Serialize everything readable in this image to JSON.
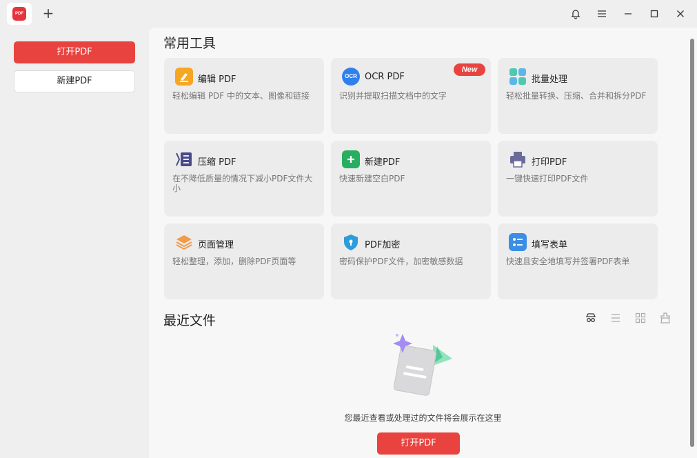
{
  "titlebar": {
    "app_logo_text": "PDF",
    "new_tab_symbol": "+",
    "icons": [
      "bell-icon",
      "menu-icon",
      "minimize-icon",
      "maximize-icon",
      "close-icon"
    ]
  },
  "sidebar": {
    "open_label": "打开PDF",
    "new_label": "新建PDF"
  },
  "tools": {
    "title": "常用工具",
    "items": [
      {
        "title": "编辑 PDF",
        "desc": "轻松编辑 PDF 中的文本、图像和链接",
        "icon": "edit-icon",
        "color": "#f5a623"
      },
      {
        "title": "OCR PDF",
        "desc": "识别并提取扫描文档中的文字",
        "icon": "ocr-icon",
        "color": "#2f80ed",
        "badge": "New",
        "icon_text": "OCR"
      },
      {
        "title": "批量处理",
        "desc": "轻松批量转换、压缩、合并和拆分PDF",
        "icon": "batch-icon",
        "color": "#4ec9b0"
      },
      {
        "title": "压缩 PDF",
        "desc": "在不降低质量的情况下减小PDF文件大小",
        "icon": "compress-icon",
        "color": "#4a4a8a"
      },
      {
        "title": "新建PDF",
        "desc": "快速新建空白PDF",
        "icon": "new-pdf-icon",
        "color": "#27ae60"
      },
      {
        "title": "打印PDF",
        "desc": "一键快速打印PDF文件",
        "icon": "print-icon",
        "color": "#6b6b9a"
      },
      {
        "title": "页面管理",
        "desc": "轻松整理，添加，删除PDF页面等",
        "icon": "pages-icon",
        "color": "#f2994a"
      },
      {
        "title": "PDF加密",
        "desc": "密码保护PDF文件，加密敏感数据",
        "icon": "lock-icon",
        "color": "#2d9cdb"
      },
      {
        "title": "填写表单",
        "desc": "快速且安全地填写并签署PDF表单",
        "icon": "form-icon",
        "color": "#3a8ee6"
      }
    ]
  },
  "recent": {
    "title": "最近文件",
    "view_icons": [
      "privacy-mode-icon",
      "list-view-icon",
      "grid-view-icon",
      "clean-icon"
    ],
    "empty_message": "您最近查看或处理过的文件将会展示在这里",
    "open_label": "打开PDF"
  }
}
